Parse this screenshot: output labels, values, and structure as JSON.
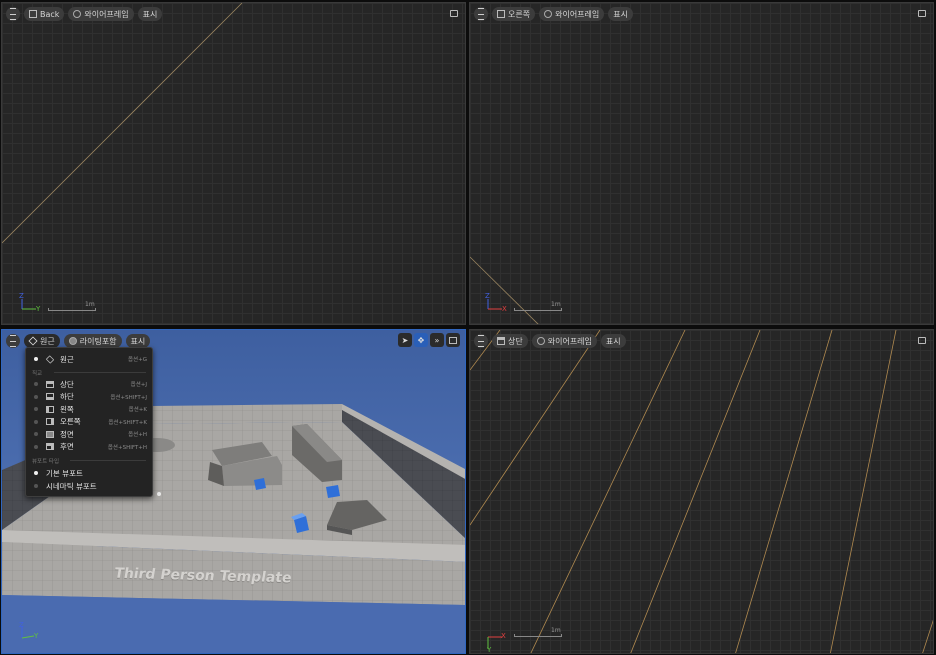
{
  "viewports": {
    "top_left": {
      "view_label": "Back",
      "mode_label": "와이어프레임",
      "show_label": "표시",
      "axis_h": "Y",
      "axis_v": "Z",
      "scale_label": "1m"
    },
    "top_right": {
      "view_label": "오른쪽",
      "mode_label": "와이어프레임",
      "show_label": "표시",
      "axis_h": "X",
      "axis_v": "Z",
      "scale_label": "1m"
    },
    "bottom_left": {
      "view_label": "원근",
      "mode_label": "라이팅포함",
      "show_label": "표시",
      "axis_h": "Y",
      "axis_v": "Z",
      "scene_text": "Third Person Template",
      "tools": [
        "select-tool",
        "move-tool",
        "more-tools"
      ]
    },
    "bottom_right": {
      "view_label": "상단",
      "mode_label": "와이어프레임",
      "show_label": "표시",
      "axis_h": "X",
      "axis_v": "Y",
      "scale_label": "1m"
    }
  },
  "view_menu": {
    "perspective": {
      "label": "원근",
      "shortcut": "옵션+G"
    },
    "ortho_section": "직교",
    "ortho_items": [
      {
        "label": "상단",
        "shortcut": "옵션+J",
        "icon": "top-view-icon"
      },
      {
        "label": "하단",
        "shortcut": "옵션+SHIFT+J",
        "icon": "bottom-view-icon"
      },
      {
        "label": "왼쪽",
        "shortcut": "옵션+K",
        "icon": "left-view-icon"
      },
      {
        "label": "오른쪽",
        "shortcut": "옵션+SHIFT+K",
        "icon": "right-view-icon"
      },
      {
        "label": "정면",
        "shortcut": "옵션+H",
        "icon": "front-view-icon"
      },
      {
        "label": "후면",
        "shortcut": "옵션+SHIFT+H",
        "icon": "back-view-icon"
      }
    ],
    "type_section": "뷰포트 타입",
    "type_items": [
      {
        "label": "기본 뷰포트",
        "selected": true
      },
      {
        "label": "시네마틱 뷰포트",
        "selected": false
      }
    ]
  },
  "colors": {
    "grid_bg": "#262626",
    "accent_blue": "#2a5fb8",
    "axis_x": "#e04040",
    "axis_y": "#60c040",
    "axis_z": "#4060e0",
    "wire_orange": "#b08a50"
  }
}
